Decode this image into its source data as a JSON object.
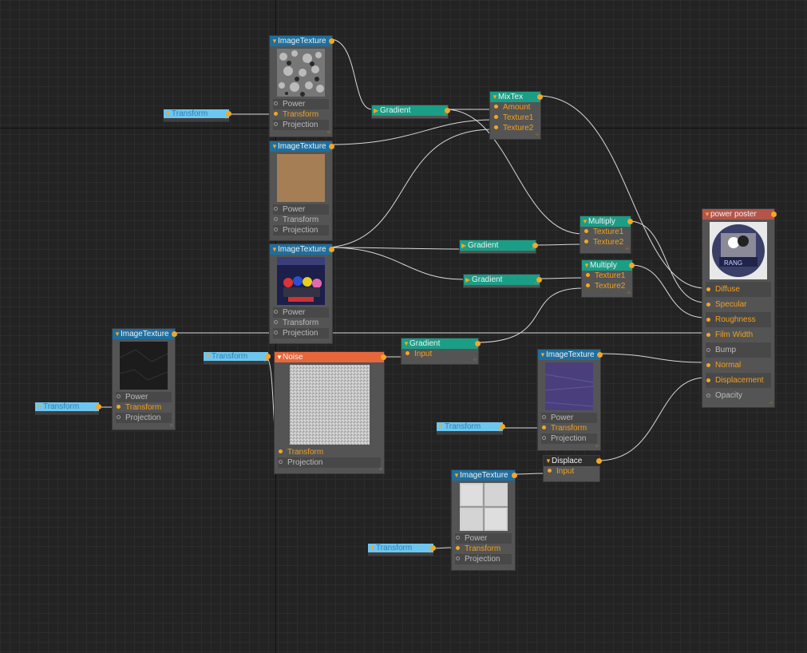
{
  "nodes": {
    "img1": {
      "title": "ImageTexture",
      "power": "Power",
      "transform": "Transform",
      "projection": "Projection"
    },
    "img2": {
      "title": "ImageTexture",
      "power": "Power",
      "transform": "Transform",
      "projection": "Projection"
    },
    "img3": {
      "title": "ImageTexture",
      "power": "Power",
      "transform": "Transform",
      "projection": "Projection"
    },
    "img4": {
      "title": "ImageTexture",
      "power": "Power",
      "transform": "Transform",
      "projection": "Projection"
    },
    "img5": {
      "title": "ImageTexture",
      "power": "Power",
      "transform": "Transform",
      "projection": "Projection"
    },
    "img6": {
      "title": "ImageTexture",
      "power": "Power",
      "transform": "Transform",
      "projection": "Projection"
    },
    "noise": {
      "title": "Noise",
      "transform": "Transform",
      "projection": "Projection"
    },
    "gradient1": {
      "title": "Gradient"
    },
    "gradient2": {
      "title": "Gradient"
    },
    "gradient3": {
      "title": "Gradient"
    },
    "gradient4": {
      "title": "Gradient",
      "input": "Input"
    },
    "mixtex": {
      "title": "MixTex",
      "amount": "Amount",
      "texture1": "Texture1",
      "texture2": "Texture2"
    },
    "multiply1": {
      "title": "Multiply",
      "texture1": "Texture1",
      "texture2": "Texture2"
    },
    "multiply2": {
      "title": "Multiply",
      "texture1": "Texture1",
      "texture2": "Texture2"
    },
    "displace": {
      "title": "Displace",
      "input": "Input"
    },
    "material": {
      "title": "power poster",
      "inputs": [
        "Diffuse",
        "Specular",
        "Roughness",
        "Film Width",
        "Bump",
        "Normal",
        "Displacement",
        "Opacity"
      ]
    },
    "transforms": {
      "t1": "Transform",
      "t2": "Transform",
      "t3": "Transform",
      "t4": "Transform",
      "t5": "Transform"
    }
  },
  "thumbnails": {
    "img1": "noise-pebbles",
    "img2": "tan-leather",
    "img3": "movie-poster",
    "img4": "dark-rock",
    "img5": "purple-normal-map",
    "img6": "grey-tile-normal",
    "noise": "white-noise",
    "material": "poster-sphere-preview"
  },
  "colors": {
    "accent": "#f5a623",
    "blue_header": "#1e6e9e",
    "teal_header": "#1a9e86",
    "noise_header": "#e8663a",
    "material_header": "#b5544a",
    "transform": "#6ec6ef"
  }
}
